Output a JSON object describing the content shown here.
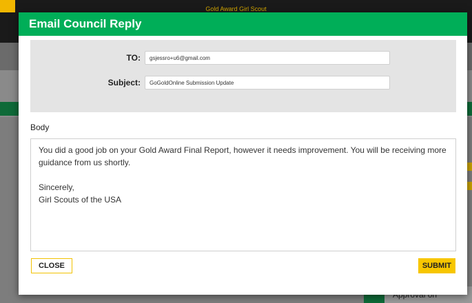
{
  "background": {
    "brand_text": "Gold Award Girl Scout",
    "approval_text": "Approval on"
  },
  "modal": {
    "title": "Email Council Reply",
    "to_label": "TO:",
    "to_value": "gsjessro+u6@gmail.com",
    "subject_label": "Subject:",
    "subject_value": "GoGoldOnline Submission Update",
    "body_label": "Body",
    "body_text": "You did a good job on your Gold Award Final Report, however it needs improvement. You will be receiving more guidance from us shortly.\n\nSincerely,\nGirl Scouts of the USA",
    "close_label": "CLOSE",
    "submit_label": "SUBMIT"
  },
  "colors": {
    "header_green": "#00ae58",
    "button_yellow": "#f7c600",
    "panel_gray": "#e4e4e4"
  }
}
